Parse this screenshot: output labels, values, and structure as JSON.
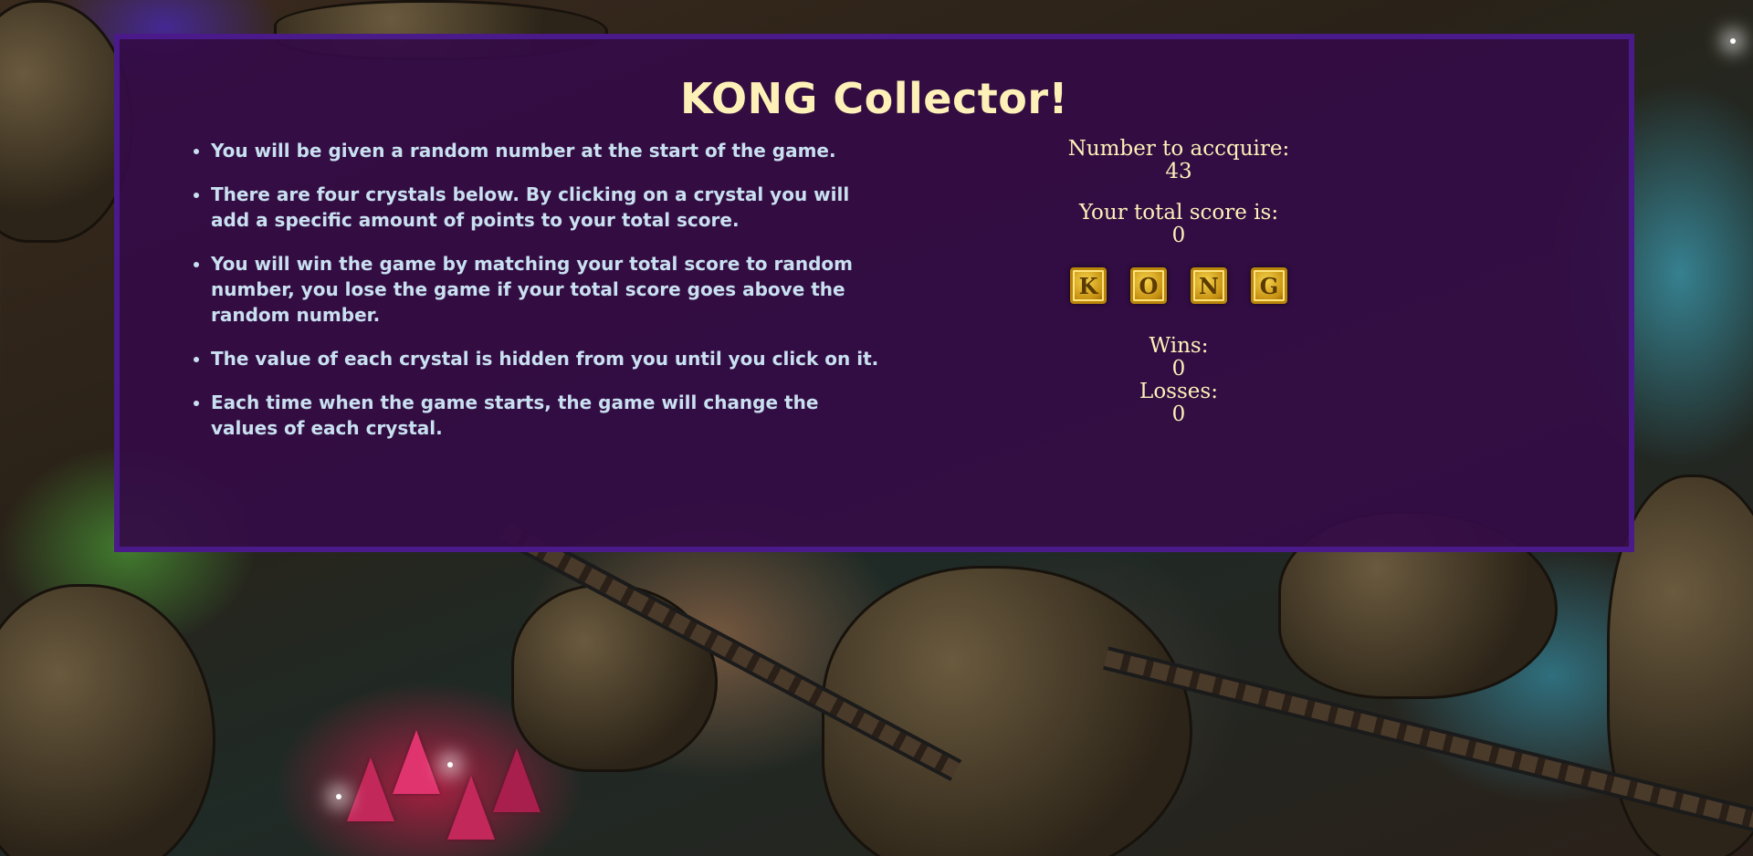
{
  "game": {
    "title": "KONG Collector!"
  },
  "instructions": [
    "You will be given a random number at the start of the game.",
    "There are four crystals below. By clicking on a crystal you will add a specific amount of points to your total score.",
    "You will win the game by matching your total score to random number, you lose the game if your total score goes above the random number.",
    "The value of each crystal is hidden from you until you click on it.",
    "Each time when the game starts, the game will change the values of each crystal."
  ],
  "stats": {
    "target_label": "Number to accquire:",
    "target_value": "43",
    "score_label": "Your total score is:",
    "score_value": "0",
    "wins_label": "Wins:",
    "wins_value": "0",
    "losses_label": "Losses:",
    "losses_value": "0"
  },
  "crystals": [
    {
      "letter": "K",
      "icon": "gold-crystal-k"
    },
    {
      "letter": "O",
      "icon": "gold-crystal-o"
    },
    {
      "letter": "N",
      "icon": "gold-crystal-n"
    },
    {
      "letter": "G",
      "icon": "gold-crystal-g"
    }
  ],
  "colors": {
    "panel_border": "#4a1a8a",
    "panel_background": "#340c46",
    "title": "#fdf1b8",
    "instruction_text": "#c9e0f0",
    "crystal_gold": "#f6d24a"
  }
}
